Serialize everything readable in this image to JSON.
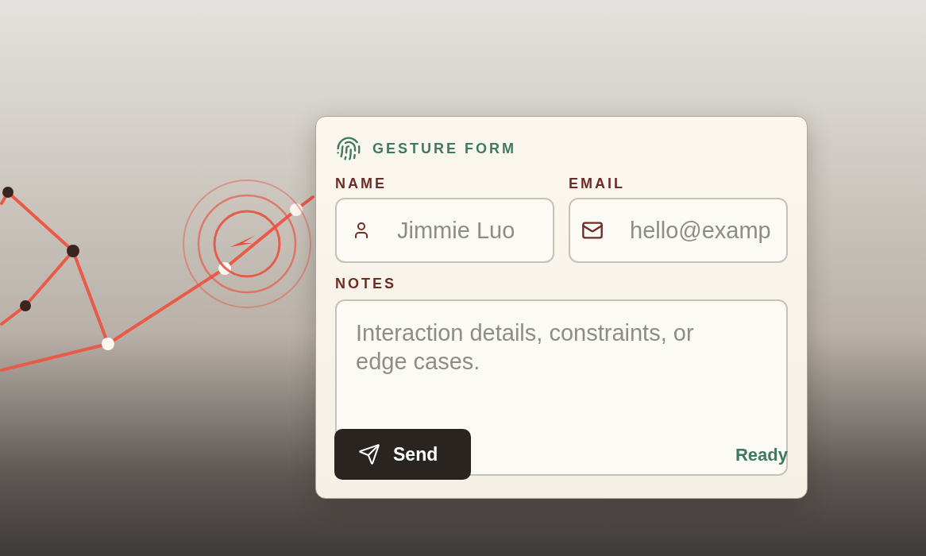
{
  "form": {
    "title": "GESTURE FORM",
    "fields": [
      {
        "kind": "name",
        "label": "NAME",
        "placeholder": "Jimmie Luo"
      },
      {
        "kind": "email",
        "label": "EMAIL",
        "placeholder": "hello@examp"
      }
    ],
    "notes": {
      "label": "NOTES",
      "placeholder": "Interaction details, constraints, or edge cases."
    },
    "send_button": {
      "label": "Send"
    },
    "status": "Ready"
  }
}
